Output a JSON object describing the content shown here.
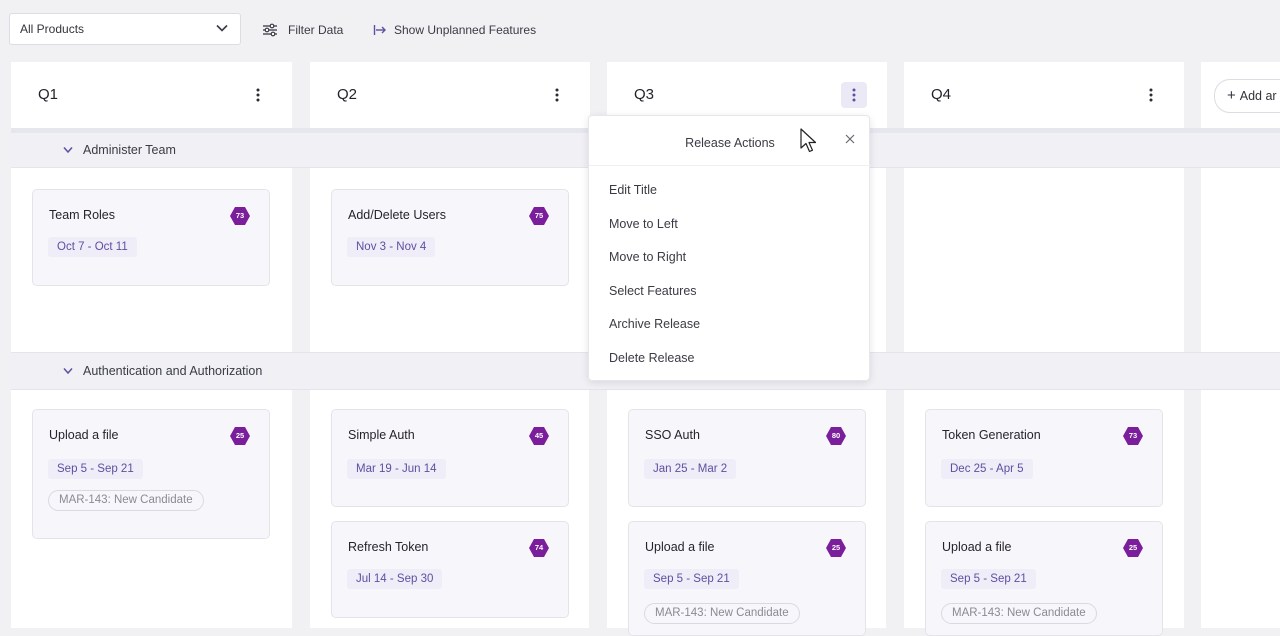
{
  "toolbar": {
    "product_select": "All Products",
    "filter_label": "Filter Data",
    "unplanned_label": "Show Unplanned Features"
  },
  "columns": [
    {
      "title": "Q1"
    },
    {
      "title": "Q2"
    },
    {
      "title": "Q3"
    },
    {
      "title": "Q4"
    }
  ],
  "add_release_label": "Add ar",
  "groups": [
    {
      "label": "Administer Team"
    },
    {
      "label": "Authentication and Authorization"
    }
  ],
  "cards": [
    {
      "title": "Team Roles",
      "badge": "73",
      "dates": "Oct 7 - Oct 11"
    },
    {
      "title": "Add/Delete Users",
      "badge": "75",
      "dates": "Nov 3 - Nov 4"
    },
    {
      "title": "Upload a file",
      "badge": "25",
      "dates": "Sep 5 - Sep 21",
      "tag": "MAR-143: New Candidate"
    },
    {
      "title": "Simple Auth",
      "badge": "45",
      "dates": "Mar 19 - Jun 14"
    },
    {
      "title": "Refresh Token",
      "badge": "74",
      "dates": "Jul 14 - Sep 30"
    },
    {
      "title": "SSO Auth",
      "badge": "80",
      "dates": "Jan 25 - Mar 2"
    },
    {
      "title": "Upload a file",
      "badge": "25",
      "dates": "Sep 5 - Sep 21",
      "tag": "MAR-143: New Candidate"
    },
    {
      "title": "Token Generation",
      "badge": "73",
      "dates": "Dec 25 - Apr 5"
    },
    {
      "title": "Upload a file",
      "badge": "25",
      "dates": "Sep 5 - Sep 21",
      "tag": "MAR-143: New Candidate"
    }
  ],
  "popup": {
    "title": "Release Actions",
    "items": [
      "Edit Title",
      "Move to Left",
      "Move to Right",
      "Select Features",
      "Archive Release",
      "Delete Release"
    ]
  },
  "colors": {
    "badge": "#7a1e9c",
    "accent": "#5f4fa0"
  },
  "icons": {
    "filter": "sliders-icon",
    "unplanned": "arrow-right-bar-icon",
    "kebab": "vertical-dots-icon",
    "close": "close-icon",
    "add": "plus-icon"
  }
}
